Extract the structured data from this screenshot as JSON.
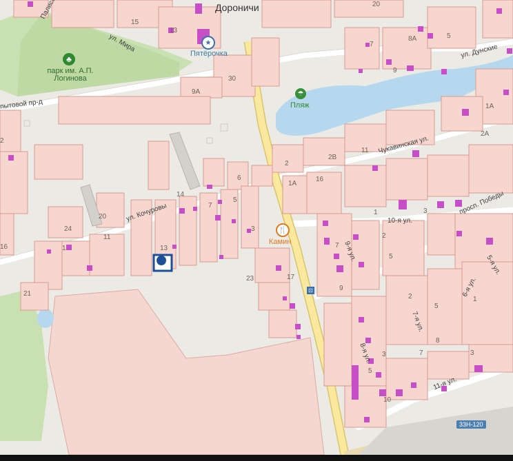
{
  "map": {
    "places": {
      "village": "Дороничи"
    },
    "parks": {
      "park": "парк им. А.П.\nЛогинова"
    },
    "pois": {
      "store": "Пятёрочка",
      "beach": "Пляж",
      "cafe": "Камин"
    },
    "streets": {
      "mira": "ул. Мира",
      "palisadnaya": "Палисадн",
      "opytovoy": "пытовой пр-д",
      "dunskie": "ул. Дунские",
      "chukavinskaya": "Чукавинская ул.",
      "kochurovy": "ул. Кочуровы",
      "pobedy": "просп. Победы",
      "ul10": "10-я ул.",
      "ul9": "9-я ул.",
      "ul7": "7-я ул.",
      "ul8": "8-я ул.",
      "ul6": "6-я ул.",
      "ul5": "5-я ул.",
      "ul11": "11-я ул."
    },
    "road_badge": "33Н-120",
    "house_numbers": {
      "n20top": "20",
      "n15": "15",
      "n13top": "13",
      "n30": "30",
      "n9a": "9А",
      "n8a": "8А",
      "n5top": "5",
      "n7top": "7",
      "n9top": "9",
      "n1a_top": "1А",
      "n2a": "2А",
      "n2": "2",
      "n2b": "2В",
      "n11": "11",
      "n1a": "1А",
      "n16": "16",
      "n6": "6",
      "n14": "14",
      "n7": "7",
      "n5": "5",
      "n20": "20",
      "n24": "24",
      "n11l": "11",
      "n13": "13",
      "n3": "3",
      "n1": "1",
      "n16l": "16",
      "n21": "21",
      "n23": "23",
      "n9": "9",
      "n17": "17",
      "n7r": "7",
      "n5r": "5",
      "n3r": "3",
      "n2r": "2",
      "n1r": "1",
      "n8": "8",
      "n7b": "7",
      "n3b": "3",
      "n5b": "5",
      "n2left": "2",
      "n2c": "2",
      "n5c": "5",
      "n3c": "3",
      "n1c": "1",
      "n10": "10"
    },
    "colors": {
      "land": "#e9e7e2",
      "parcel": "#f6d6cf",
      "parcel_border": "#d99a8e",
      "building": "#c64ec6",
      "park": "#c8e0b0",
      "water": "#b5d6ee",
      "road_main": "#f9e79a",
      "marker": "#1d4f99"
    }
  }
}
